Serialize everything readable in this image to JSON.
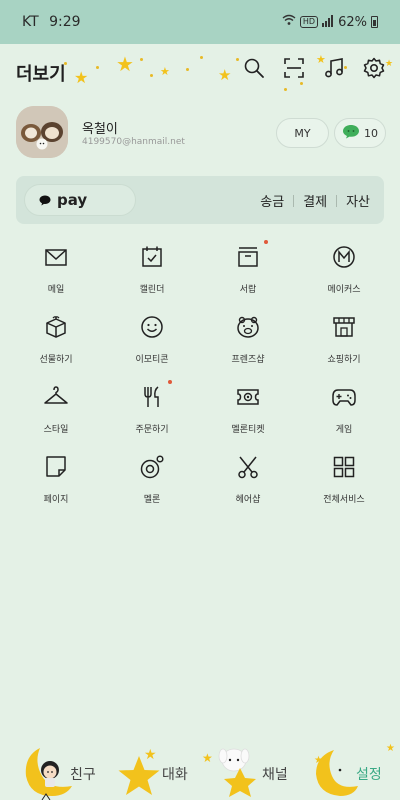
{
  "status_bar": {
    "carrier": "KT",
    "time": "9:29",
    "battery": "62%",
    "hd": "HD"
  },
  "header": {
    "title": "더보기",
    "icons": [
      "search-icon",
      "scan-icon",
      "music-icon",
      "settings-icon"
    ]
  },
  "profile": {
    "name": "옥철이",
    "email": "4199570@hanmail.net",
    "my_button": "MY",
    "coin_count": "10"
  },
  "pay": {
    "label": "pay",
    "actions": [
      "송금",
      "결제",
      "자산"
    ]
  },
  "services": [
    {
      "label": "메일",
      "icon": "mail-icon",
      "new": false
    },
    {
      "label": "캘린더",
      "icon": "calendar-icon",
      "new": false
    },
    {
      "label": "서랍",
      "icon": "drawer-icon",
      "new": true
    },
    {
      "label": "메이커스",
      "icon": "makers-icon",
      "new": false
    },
    {
      "label": "선물하기",
      "icon": "gift-icon",
      "new": false
    },
    {
      "label": "이모티콘",
      "icon": "emoticon-icon",
      "new": false
    },
    {
      "label": "프렌즈샵",
      "icon": "friends-shop-icon",
      "new": false
    },
    {
      "label": "쇼핑하기",
      "icon": "shopping-icon",
      "new": false
    },
    {
      "label": "스타일",
      "icon": "hanger-icon",
      "new": false
    },
    {
      "label": "주문하기",
      "icon": "fork-knife-icon",
      "new": true
    },
    {
      "label": "멜론티켓",
      "icon": "ticket-icon",
      "new": false
    },
    {
      "label": "게임",
      "icon": "gamepad-icon",
      "new": false
    },
    {
      "label": "페이지",
      "icon": "page-icon",
      "new": false
    },
    {
      "label": "멜론",
      "icon": "melon-icon",
      "new": false
    },
    {
      "label": "헤어샵",
      "icon": "scissors-icon",
      "new": false
    },
    {
      "label": "전체서비스",
      "icon": "all-services-icon",
      "new": false
    }
  ],
  "tabs": [
    {
      "label": "친구",
      "icon": "moon-girl-icon",
      "active": false
    },
    {
      "label": "대화",
      "icon": "star-icon",
      "active": false
    },
    {
      "label": "채널",
      "icon": "dog-star-icon",
      "active": false
    },
    {
      "label": "설정",
      "icon": "crescent-moon-icon",
      "active": true
    }
  ],
  "colors": {
    "background": "#e4f1e6",
    "status_bar": "#a8d3c3",
    "accent": "#3aa985",
    "star": "#f2c21c",
    "badge": "#e0593a"
  }
}
